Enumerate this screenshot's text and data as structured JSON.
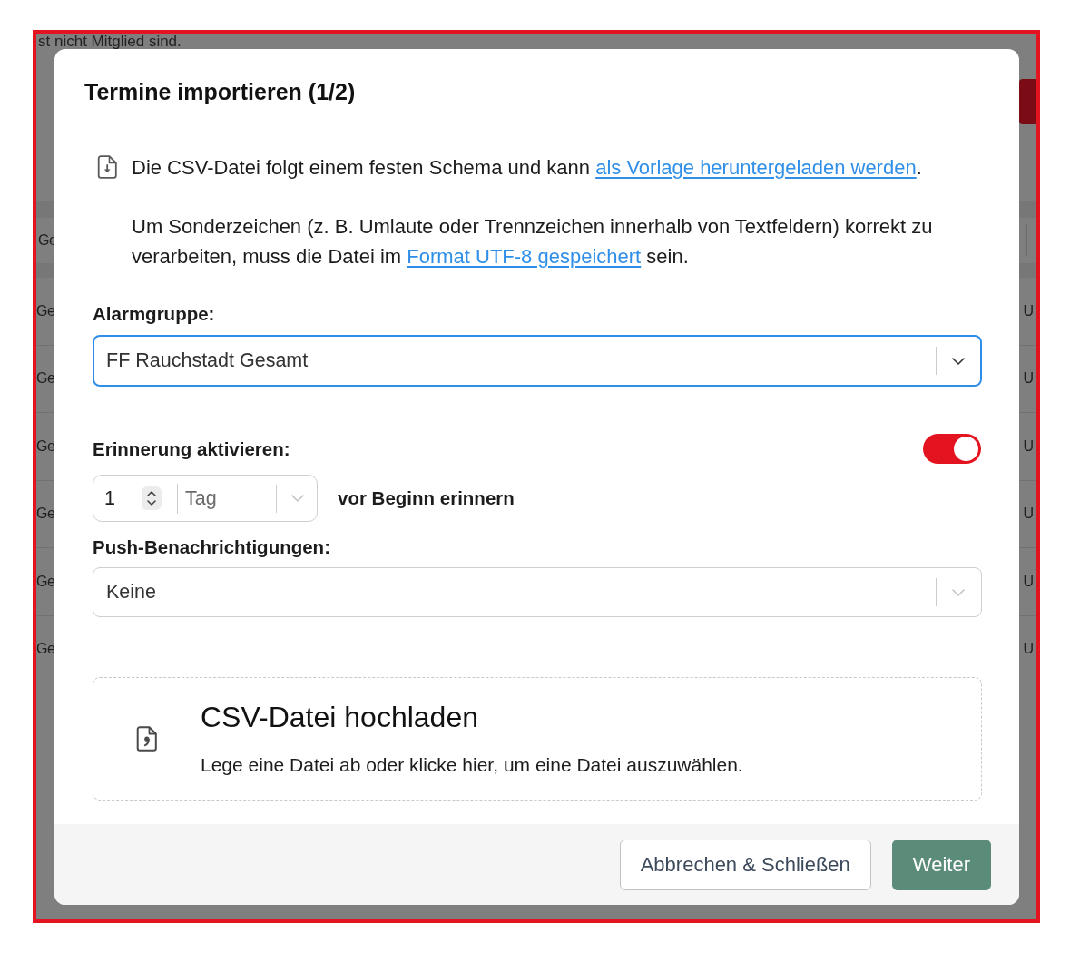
{
  "background_page": {
    "text": "st nicht Mitglied sind.",
    "table": {
      "header": "Ge",
      "rows": [
        {
          "column_1": "Ge",
          "column_2": "U"
        },
        {
          "column_1": "Ge",
          "column_2": "U"
        },
        {
          "column_1": "Ge",
          "column_2": "U"
        },
        {
          "column_1": "Ge",
          "column_2": "U"
        },
        {
          "column_1": "Ge",
          "column_2": "U"
        },
        {
          "column_1": "Ge",
          "column_2": "U"
        }
      ]
    }
  },
  "dialog": {
    "title": "Termine importieren (1/2)",
    "info": {
      "text": "Die CSV-Datei folgt einem festen Schema und kann",
      "link": "als Vorlage heruntergeladen werden",
      "end": "."
    },
    "encoding_hint": {
      "text": "Um Sonderzeichen (z. B. Umlaute oder Trennzeichen innerhalb von Textfeldern) korrekt zu verarbeiten, muss die Datei im",
      "link": "Format UTF-8 gespeichert",
      "end": "sein."
    },
    "alarm_group": {
      "label": "Alarmgruppe:",
      "value": "FF Rauchstadt Gesamt",
      "focused": true
    },
    "reminder": {
      "label": "Erinnerung aktivieren:",
      "on": true,
      "amount": "1",
      "unit": "Tag",
      "suffix": "vor Beginn erinnern"
    },
    "push": {
      "label": "Push-Benachrichtigungen:",
      "value": "Keine",
      "focused": false
    },
    "upload": {
      "title": "CSV-Datei hochladen",
      "hint": "Lege eine Datei ab oder klicke hier, um eine Datei auszuwählen."
    },
    "buttons": [
      {
        "label": "Abbrechen & Schließen",
        "kind": "secondary"
      },
      {
        "label": "Weiter",
        "kind": "primary"
      }
    ]
  }
}
